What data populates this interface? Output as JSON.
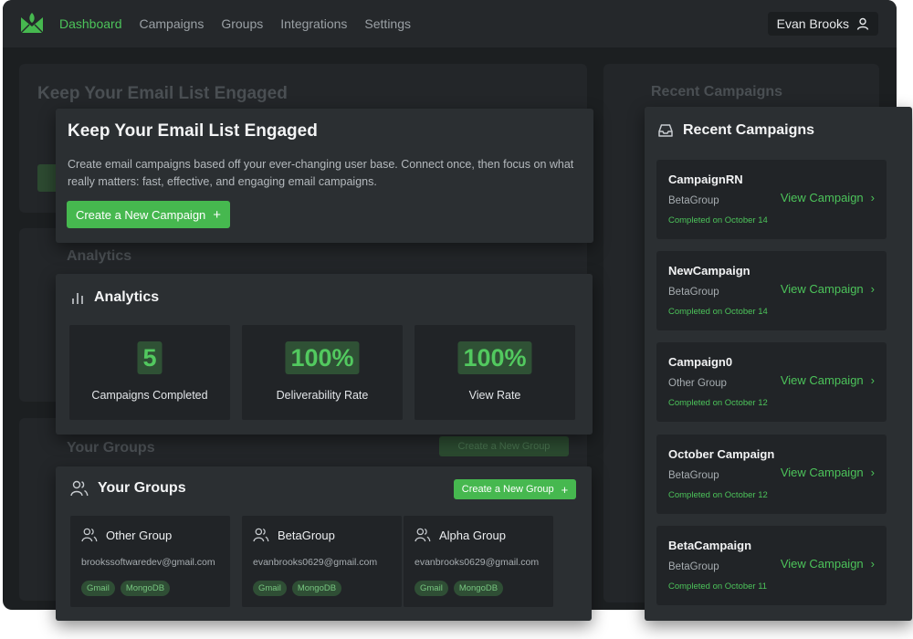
{
  "nav": {
    "links": [
      "Dashboard",
      "Campaigns",
      "Groups",
      "Integrations",
      "Settings"
    ],
    "active": "Dashboard",
    "user_name": "Evan Brooks"
  },
  "background": {
    "hero_title": "Keep Your Email List Engaged",
    "analytics_title": "Analytics",
    "groups_title": "Your Groups",
    "groups_button": "Create a New Group",
    "recent_title": "Recent Campaigns"
  },
  "hero": {
    "title": "Keep Your Email List Engaged",
    "description": "Create email campaigns based off your ever-changing user base. Connect once, then focus on what really matters: fast, effective, and engaging email campaigns.",
    "button_label": "Create a New Campaign"
  },
  "analytics": {
    "title": "Analytics",
    "stats": [
      {
        "value": "5",
        "label": "Campaigns Completed"
      },
      {
        "value": "100%",
        "label": "Deliverability Rate"
      },
      {
        "value": "100%",
        "label": "View Rate"
      }
    ]
  },
  "groups": {
    "title": "Your Groups",
    "button_label": "Create a New Group",
    "items": [
      {
        "name": "Other Group",
        "email": "brookssoftwaredev@gmail.com",
        "tags": [
          "Gmail",
          "MongoDB"
        ]
      },
      {
        "name": "BetaGroup",
        "email": "evanbrooks0629@gmail.com",
        "tags": [
          "Gmail",
          "MongoDB"
        ]
      },
      {
        "name": "Alpha Group",
        "email": "evanbrooks0629@gmail.com",
        "tags": [
          "Gmail",
          "MongoDB"
        ]
      }
    ]
  },
  "recent": {
    "title": "Recent Campaigns",
    "link_label": "View Campaign",
    "items": [
      {
        "name": "CampaignRN",
        "group": "BetaGroup",
        "date": "Completed on October 14"
      },
      {
        "name": "NewCampaign",
        "group": "BetaGroup",
        "date": "Completed on October 14"
      },
      {
        "name": "Campaign0",
        "group": "Other Group",
        "date": "Completed on October 12"
      },
      {
        "name": "October Campaign",
        "group": "BetaGroup",
        "date": "Completed on October 12"
      },
      {
        "name": "BetaCampaign",
        "group": "BetaGroup",
        "date": "Completed on October 11"
      }
    ]
  },
  "colors": {
    "accent": "#46b84f",
    "accent_text": "#4cc35a",
    "background": "#1c1f21",
    "panel": "#2b2f32",
    "card": "#212427"
  }
}
